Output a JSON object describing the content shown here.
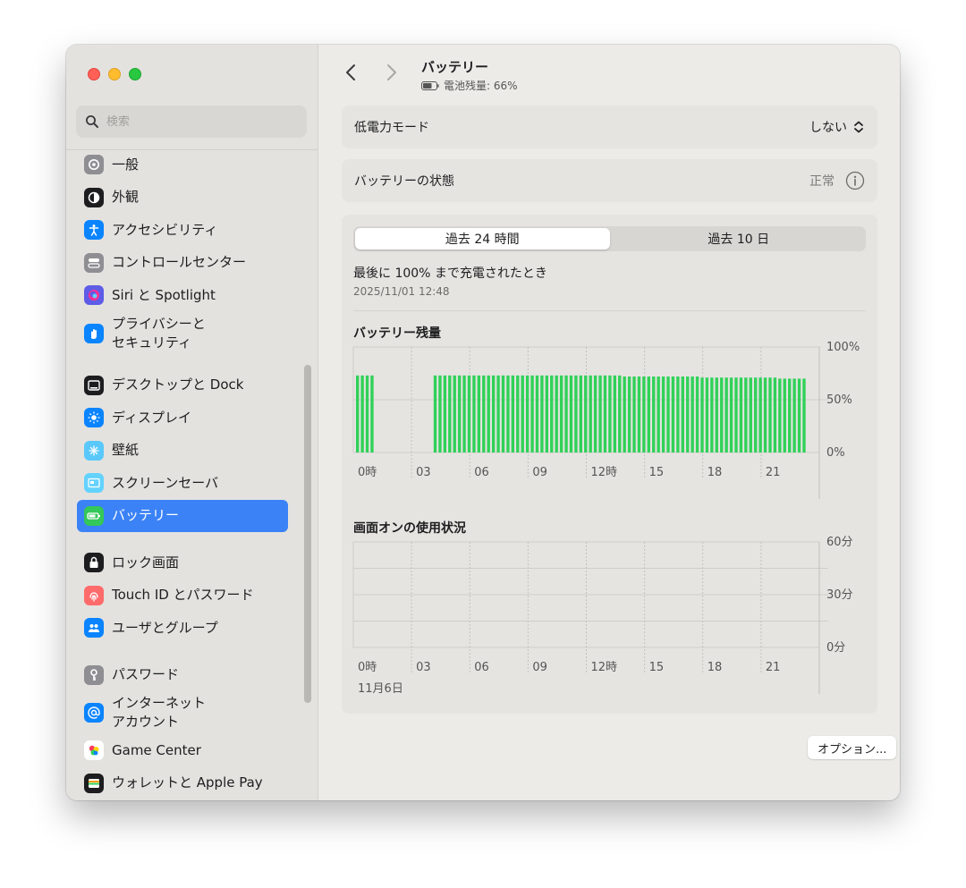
{
  "window": {
    "title": "バッテリー",
    "subtitle": "電池残量: 66%"
  },
  "search": {
    "placeholder": "検索"
  },
  "sidebar": {
    "items": [
      {
        "label": "一般",
        "icon": "gear-icon",
        "color": "#8e8e93"
      },
      {
        "label": "外観",
        "icon": "appearance-icon",
        "color": "#1d1d1f"
      },
      {
        "label": "アクセシビリティ",
        "icon": "accessibility-icon",
        "color": "#0a84ff"
      },
      {
        "label": "コントロールセンター",
        "icon": "control-center-icon",
        "color": "#8e8e93"
      },
      {
        "label": "Siri と Spotlight",
        "icon": "siri-icon",
        "color": "#5e5ce6"
      },
      {
        "label": "プライバシーと\nセキュリティ",
        "icon": "hand-icon",
        "color": "#0a84ff"
      },
      {
        "label": "デスクトップと Dock",
        "icon": "desktop-dock-icon",
        "color": "#1d1d1f"
      },
      {
        "label": "ディスプレイ",
        "icon": "display-icon",
        "color": "#0a84ff"
      },
      {
        "label": "壁紙",
        "icon": "wallpaper-icon",
        "color": "#5ac8fa"
      },
      {
        "label": "スクリーンセーバ",
        "icon": "screensaver-icon",
        "color": "#64d2ff"
      },
      {
        "label": "バッテリー",
        "icon": "battery-icon",
        "color": "#34c759",
        "active": true
      },
      {
        "label": "ロック画面",
        "icon": "lock-icon",
        "color": "#1d1d1f"
      },
      {
        "label": "Touch ID とパスワード",
        "icon": "fingerprint-icon",
        "color": "#ff6b6b"
      },
      {
        "label": "ユーザとグループ",
        "icon": "users-icon",
        "color": "#0a84ff"
      },
      {
        "label": "パスワード",
        "icon": "key-icon",
        "color": "#8e8e93"
      },
      {
        "label": "インターネット\nアカウント",
        "icon": "at-icon",
        "color": "#0a84ff"
      },
      {
        "label": "Game Center",
        "icon": "game-center-icon",
        "color": "#ff9f0a"
      },
      {
        "label": "ウォレットと Apple Pay",
        "icon": "wallet-icon",
        "color": "#1d1d1f"
      }
    ]
  },
  "low_power": {
    "label": "低電力モード",
    "value": "しない"
  },
  "battery_health": {
    "label": "バッテリーの状態",
    "value": "正常"
  },
  "tabs": {
    "last24": "過去 24 時間",
    "last10": "過去 10 日",
    "active": "last24"
  },
  "last_full_charge": {
    "label": "最後に 100% まで充電されたとき",
    "date": "2025/11/01 12:48"
  },
  "buttons": {
    "options": "オプション...",
    "help": "?"
  },
  "colors": {
    "battery_bar": "#30d158",
    "accent": "#3b82f6"
  },
  "chart_data": [
    {
      "type": "bar",
      "title": "バッテリー残量",
      "x_ticks": [
        "0時",
        "03",
        "06",
        "09",
        "12時",
        "15",
        "18",
        "21"
      ],
      "y_ticks": [
        "100%",
        "50%",
        "0%"
      ],
      "ylim": [
        0,
        100
      ],
      "unit": "%",
      "series": [
        {
          "hours": [
            0,
            0.25,
            0.5,
            0.75
          ],
          "values": [
            73,
            73,
            73,
            73
          ]
        },
        {
          "hours": [
            4.0,
            4.25,
            4.5,
            4.75,
            5.0,
            5.25,
            5.5,
            5.75,
            6.0,
            6.25,
            6.5,
            6.75,
            7.0,
            7.25,
            7.5,
            7.75,
            8.0,
            8.25,
            8.5,
            8.75,
            9.0,
            9.25,
            9.5,
            9.75,
            10.0,
            10.25,
            10.5,
            10.75,
            11.0,
            11.25,
            11.5,
            11.75,
            12.0,
            12.25,
            12.5,
            12.75,
            13.0,
            13.25,
            13.5,
            13.75,
            14.0,
            14.25,
            14.5,
            14.75,
            15.0,
            15.25,
            15.5,
            15.75,
            16.0,
            16.25,
            16.5,
            16.75,
            17.0,
            17.25,
            17.5,
            17.75,
            18.0,
            18.25,
            18.5,
            18.75,
            19.0,
            19.25,
            19.5,
            19.75,
            20.0,
            20.25,
            20.5,
            20.75,
            21.0,
            21.25,
            21.5,
            21.75,
            22.0,
            22.25,
            22.5,
            22.75,
            23.0
          ],
          "values": [
            73,
            73,
            73,
            73,
            73,
            73,
            73,
            73,
            73,
            73,
            73,
            73,
            73,
            73,
            73,
            73,
            73,
            73,
            73,
            73,
            73,
            73,
            73,
            73,
            73,
            73,
            73,
            73,
            73,
            73,
            73,
            73,
            73,
            73,
            73,
            73,
            73,
            73,
            73,
            72,
            72,
            72,
            72,
            72,
            72,
            72,
            72,
            72,
            72,
            72,
            72,
            72,
            72,
            72,
            72,
            71,
            71,
            71,
            71,
            71,
            71,
            71,
            71,
            71,
            71,
            71,
            71,
            71,
            71,
            71,
            71,
            70,
            70,
            70,
            70,
            70,
            70
          ]
        }
      ]
    },
    {
      "type": "bar",
      "title": "画面オンの使用状況",
      "x_ticks": [
        "0時",
        "03",
        "06",
        "09",
        "12時",
        "15",
        "18",
        "21"
      ],
      "x_sub_label": "11月6日",
      "y_ticks": [
        "60分",
        "30分",
        "0分"
      ],
      "ylim": [
        0,
        60
      ],
      "unit": "分",
      "values": []
    }
  ]
}
